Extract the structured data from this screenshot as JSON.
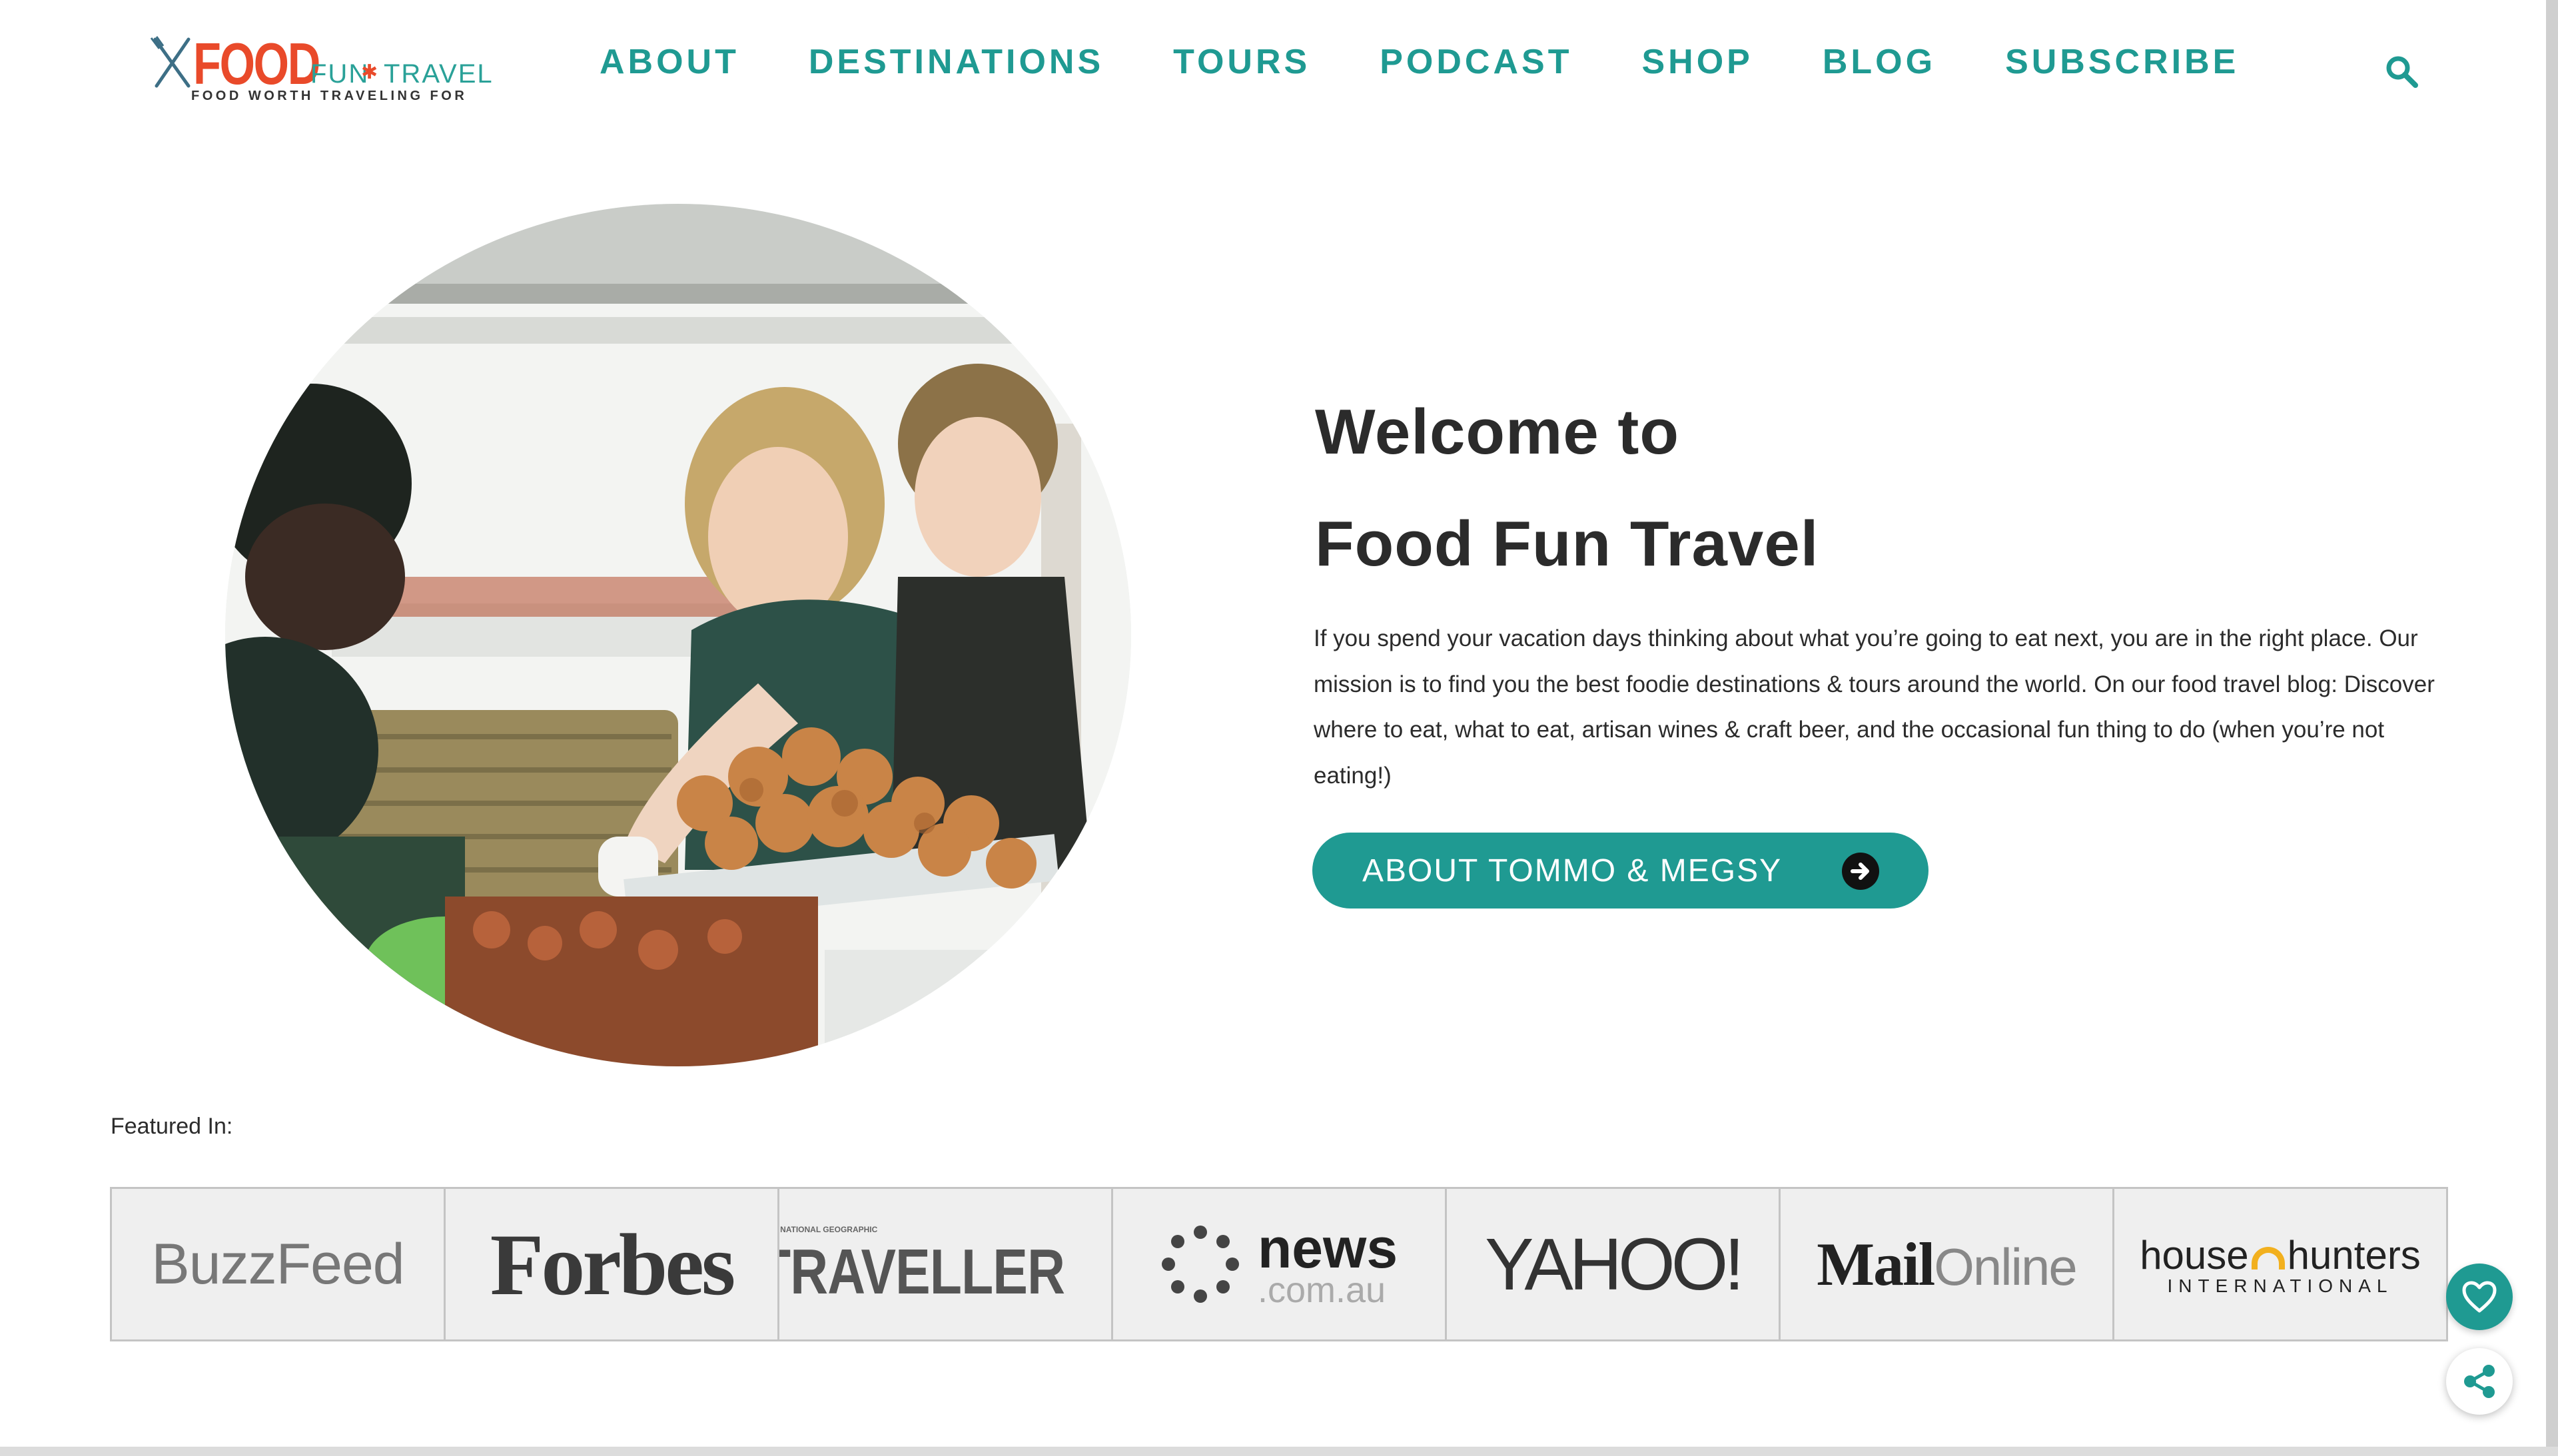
{
  "logo": {
    "food": "FOOD",
    "fun": "FUN",
    "travel": "TRAVEL",
    "tagline": "FOOD WORTH TRAVELING FOR"
  },
  "nav": {
    "items": [
      "ABOUT",
      "DESTINATIONS",
      "TOURS",
      "PODCAST",
      "SHOP",
      "BLOG",
      "SUBSCRIBE"
    ]
  },
  "hero": {
    "title_line1": "Welcome to",
    "title_line2": "Food Fun Travel",
    "body": "If you spend your vacation days thinking about what you’re going to eat next, you are in the right place. Our mission is to find you the best foodie destinations & tours around the world. On our food travel blog: Discover where to eat, what to eat, artisan wines & craft beer, and the occasional fun thing to do (when you’re not eating!)",
    "button_label": "ABOUT TOMMO & MEGSY"
  },
  "featured": {
    "label": "Featured In:",
    "buzzfeed": "BuzzFeed",
    "forbes": "Forbes",
    "traveller_small": "NATIONAL GEOGRAPHIC",
    "traveller": "TRAVELLER",
    "news_top": "news",
    "news_bottom": ".com.au",
    "yahoo": "YAHOO!",
    "mail_bold": "Mail",
    "mail_light": "Online",
    "hh_house": "house",
    "hh_hunters": "hunters",
    "hh_sub": "INTERNATIONAL"
  },
  "colors": {
    "accent": "#1f9a92",
    "brand_red": "#e94a2a",
    "text": "#2b2b2b"
  },
  "icons": {
    "search": "search-icon",
    "arrow": "arrow-right-circle-icon",
    "heart": "heart-icon",
    "share": "share-icon"
  }
}
